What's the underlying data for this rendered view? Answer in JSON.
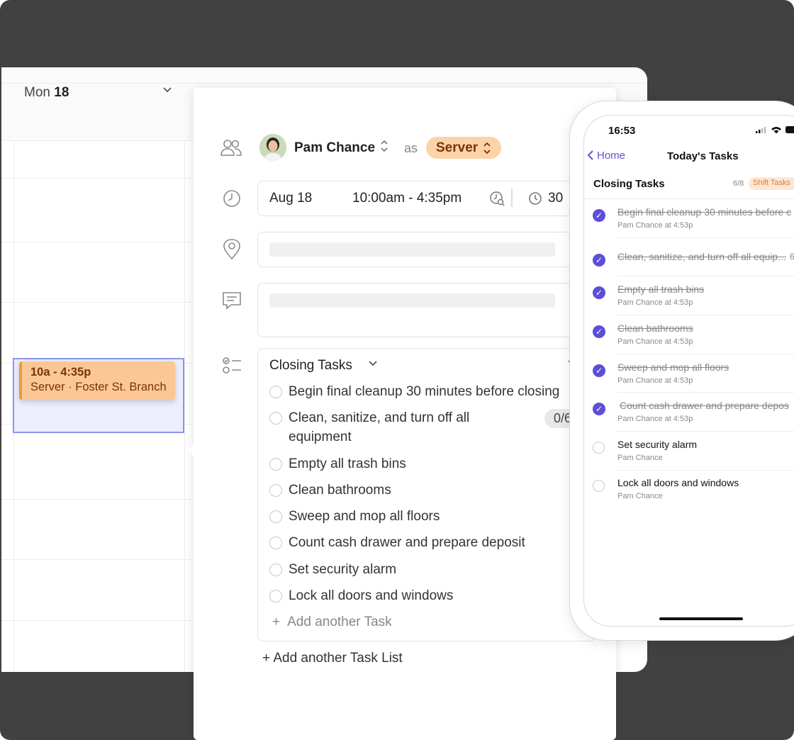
{
  "calendar": {
    "day_name": "Mon",
    "day_num": "18",
    "shift": {
      "time": "10a - 4:35p",
      "detail": "Server · Foster St. Branch"
    }
  },
  "panel": {
    "person": "Pam Chance",
    "as_label": "as",
    "role": "Server",
    "date": "Aug 18",
    "time_range": "10:00am - 4:35pm",
    "duration": "30",
    "task_list_title": "Closing Tasks",
    "tasks": [
      "Begin final cleanup 30 minutes before closing",
      "Clean, sanitize, and turn off all",
      "Empty all trash bins",
      "Clean bathrooms",
      "Sweep and mop all floors",
      "Count cash drawer and prepare deposit",
      "Set security alarm",
      "Lock all doors and windows"
    ],
    "task2_line2": "equipment",
    "task2_badge": "0/6",
    "add_task": "Add another Task",
    "add_task_list": "+ Add another Task List"
  },
  "phone": {
    "time": "16:53",
    "back_label": "Home",
    "title": "Today's Tasks",
    "list_title": "Closing Tasks",
    "count": "6/8",
    "badge": "Shift Tasks",
    "items": [
      {
        "title": "Begin final cleanup 30 minutes before c",
        "sub": "Pam Chance at 4:53p",
        "done": true
      },
      {
        "title": "Clean, sanitize, and turn off all equip...",
        "sub": "",
        "done": true
      },
      {
        "title": "Empty all trash bins",
        "sub": "Pam Chance at 4:53p",
        "done": true
      },
      {
        "title": "Clean bathrooms",
        "sub": "Pam Chance at 4:53p",
        "done": true
      },
      {
        "title": "Sweep and mop all floors",
        "sub": "Pam Chance at 4:53p",
        "done": true
      },
      {
        "title": "Count cash drawer and prepare depos",
        "sub": "Pam Chance at 4:53p",
        "done": true
      },
      {
        "title": "Set security alarm",
        "sub": "Pam Chance",
        "done": false
      },
      {
        "title": "Lock all doors and windows",
        "sub": "Pam Chance",
        "done": false
      }
    ]
  }
}
